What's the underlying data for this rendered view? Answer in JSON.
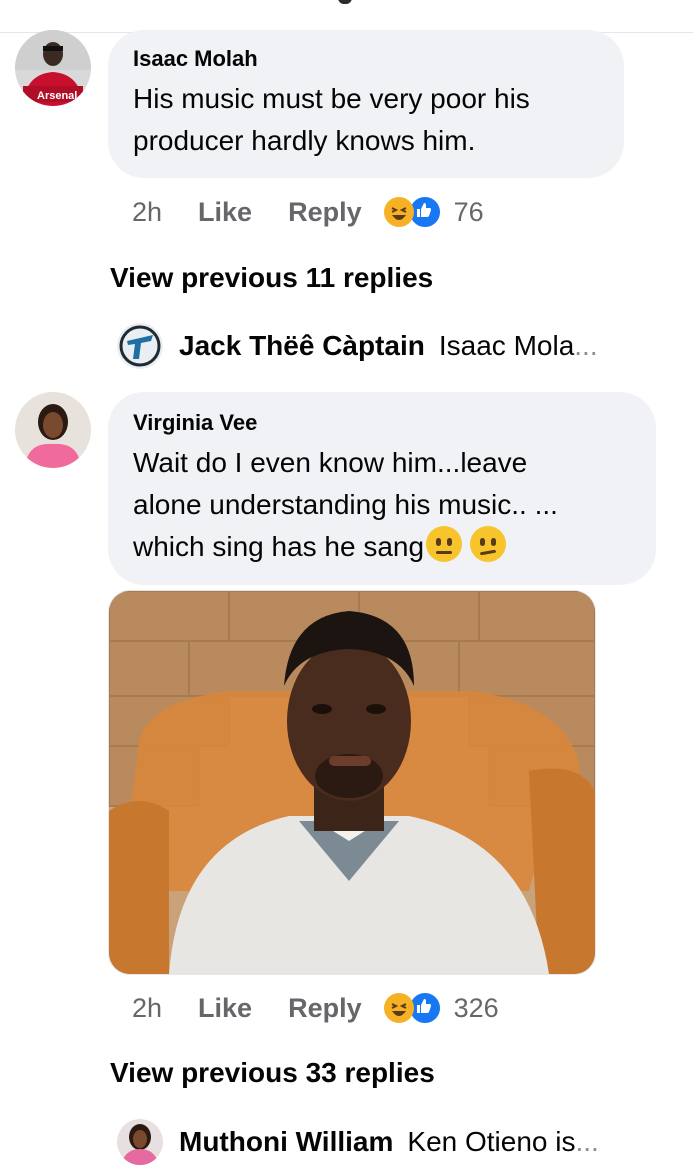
{
  "comments": [
    {
      "author": "Isaac Molah",
      "text_line1": "His music must be very poor his",
      "text_line2": "producer hardly knows him.",
      "avatar_label": "Arsenal",
      "time": "2h",
      "like_label": "Like",
      "reply_label": "Reply",
      "reaction_count": "76"
    },
    {
      "author": "Virginia Vee",
      "text_line1": "Wait do I even know him...leave",
      "text_line2": "alone understanding his music.. ...",
      "text_line3": "which sing has he sang",
      "time": "2h",
      "like_label": "Like",
      "reply_label": "Reply",
      "reaction_count": "326"
    }
  ],
  "view_previous": [
    {
      "label": "View previous 11 replies"
    },
    {
      "label": "View previous 33 replies"
    }
  ],
  "reply_previews": [
    {
      "name": "Jack Thëê Càptain",
      "snippet": "Isaac Mola",
      "ellipsis": "..."
    },
    {
      "name": "Muthoni William",
      "snippet": "Ken Otieno is",
      "ellipsis": "..."
    }
  ],
  "icons": {
    "reaction_haha": "haha-reaction-icon",
    "reaction_like": "like-reaction-icon",
    "emoji_confused": "confused-face-emoji"
  },
  "colors": {
    "bubble": "#f0f2f5",
    "meta_text": "#65676b",
    "like_blue": "#1877f2",
    "haha_yellow": "#f7b125"
  }
}
